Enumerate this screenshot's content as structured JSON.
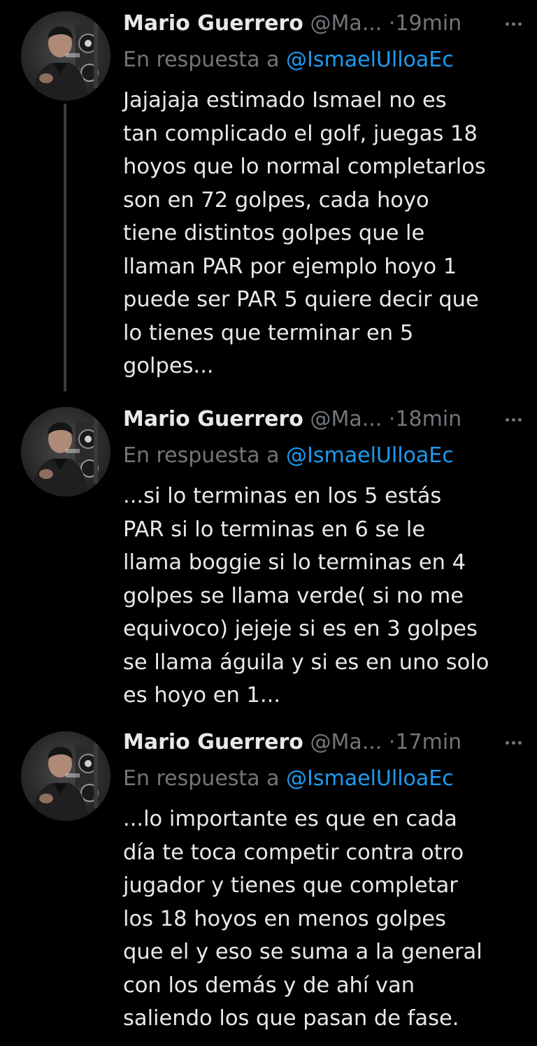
{
  "tweets": [
    {
      "author_name": "Mario Guerrero",
      "handle": "@Ma...",
      "separator": "·",
      "time": "19min",
      "reply_prefix": "En respuesta a",
      "reply_mention": "@IsmaelUlloaEc",
      "text": "Jajajaja estimado Ismael no es\ntan complicado el golf, juegas 18\nhoyos que lo normal completarlos\nson en 72 golpes, cada hoyo\ntiene distintos golpes que le\nllaman PAR por ejemplo hoyo 1\npuede ser PAR 5 quiere decir que\nlo tienes que terminar en 5\ngolpes..."
    },
    {
      "author_name": "Mario Guerrero",
      "handle": "@Ma...",
      "separator": "·",
      "time": "18min",
      "reply_prefix": "En respuesta a",
      "reply_mention": "@IsmaelUlloaEc",
      "text": "...si lo terminas en los 5 estás\nPAR si lo terminas en 6 se le\nllama boggie si lo terminas en 4\ngolpes se llama verde( si no me\nequivoco) jejeje si es en 3 golpes\nse llama águila y si es en uno solo\nes hoyo en 1..."
    },
    {
      "author_name": "Mario Guerrero",
      "handle": "@Ma...",
      "separator": "·",
      "time": "17min",
      "reply_prefix": "En respuesta a",
      "reply_mention": "@IsmaelUlloaEc",
      "text": "...lo importante es que en cada\ndía te toca competir contra otro\njugador y tienes que completar\nlos 18 hoyos en menos golpes\nque el y eso se suma a la general\ncon los demás y de ahí van\nsaliendo los que pasan de fase."
    }
  ],
  "icons": {
    "more": "more-horizontal-icon",
    "avatar": "profile-photo"
  },
  "colors": {
    "background": "#000000",
    "text": "#e7e9ea",
    "secondary": "#71767b",
    "mention": "#1d9bf0",
    "thread_line": "#3a3d41"
  }
}
